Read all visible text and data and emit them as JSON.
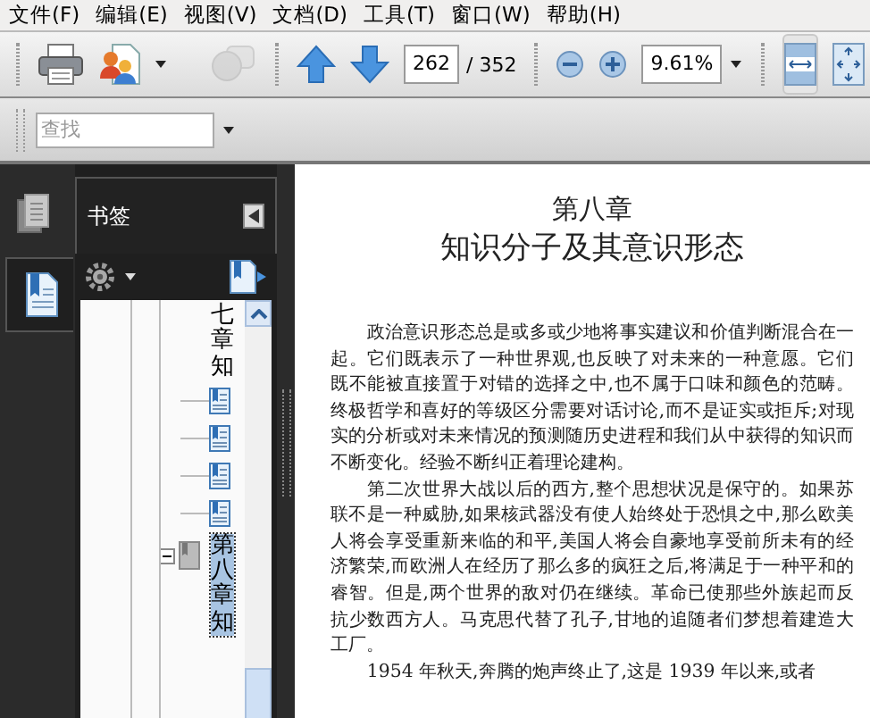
{
  "menu": [
    {
      "label": "文件(F)"
    },
    {
      "label": "编辑(E)"
    },
    {
      "label": "视图(V)"
    },
    {
      "label": "文档(D)"
    },
    {
      "label": "工具(T)"
    },
    {
      "label": "窗口(W)"
    },
    {
      "label": "帮助(H)"
    }
  ],
  "toolbar": [
    {
      "kind": "print"
    },
    {
      "kind": "collaborate"
    },
    {
      "kind": "comment",
      "disabled": true
    },
    {
      "kind": "prev_page"
    },
    {
      "kind": "next_page"
    },
    {
      "kind": "page",
      "value": "262",
      "total": "/ 352"
    },
    {
      "kind": "zoom_out"
    },
    {
      "kind": "zoom_in"
    },
    {
      "kind": "zoom",
      "value": "9.61%"
    },
    {
      "kind": "fit_width",
      "selected": true
    },
    {
      "kind": "fit_page",
      "selected": false
    }
  ],
  "find": {
    "placeholder": "查找"
  },
  "nav_tabs": [
    {
      "kind": "pages",
      "selected": false
    },
    {
      "kind": "bookmarks",
      "selected": true
    }
  ],
  "bookmarks_panel": {
    "title": "书签",
    "tree": [
      {
        "text": "七章知",
        "selected": false,
        "children": [
          {
            "selected": false
          },
          {
            "selected": false
          },
          {
            "selected": false
          },
          {
            "selected": false
          }
        ]
      },
      {
        "text": "第八章知",
        "selected": true,
        "expanded": true
      }
    ]
  },
  "document": {
    "chapter": "第八章",
    "title": "知识分子及其意识形态",
    "paragraphs": [
      "政治意识形态总是或多或少地将事实建议和价值判断混合在一起。它们既表示了一种世界观,也反映了对未来的一种意愿。它们既不能被直接置于对错的选择之中,也不属于口味和颜色的范畴。终极哲学和喜好的等级区分需要对话讨论,而不是证实或拒斥;对现实的分析或对未来情况的预测随历史进程和我们从中获得的知识而不断变化。经验不断纠正着理论建构。",
      "第二次世界大战以后的西方,整个思想状况是保守的。如果苏联不是一种威胁,如果核武器没有使人始终处于恐惧之中,那么欧美人将会享受重新来临的和平,美国人将会自豪地享受前所未有的经济繁荣,而欧洲人在经历了那么多的疯狂之后,将满足于一种平和的睿智。但是,两个世界的敌对仍在继续。革命已使那些外族起而反抗少数西方人。马克思代替了孔子,甘地的追随者们梦想着建造大工厂。",
      "1954 年秋天,奔腾的炮声终止了,这是 1939 年以来,或者"
    ]
  }
}
